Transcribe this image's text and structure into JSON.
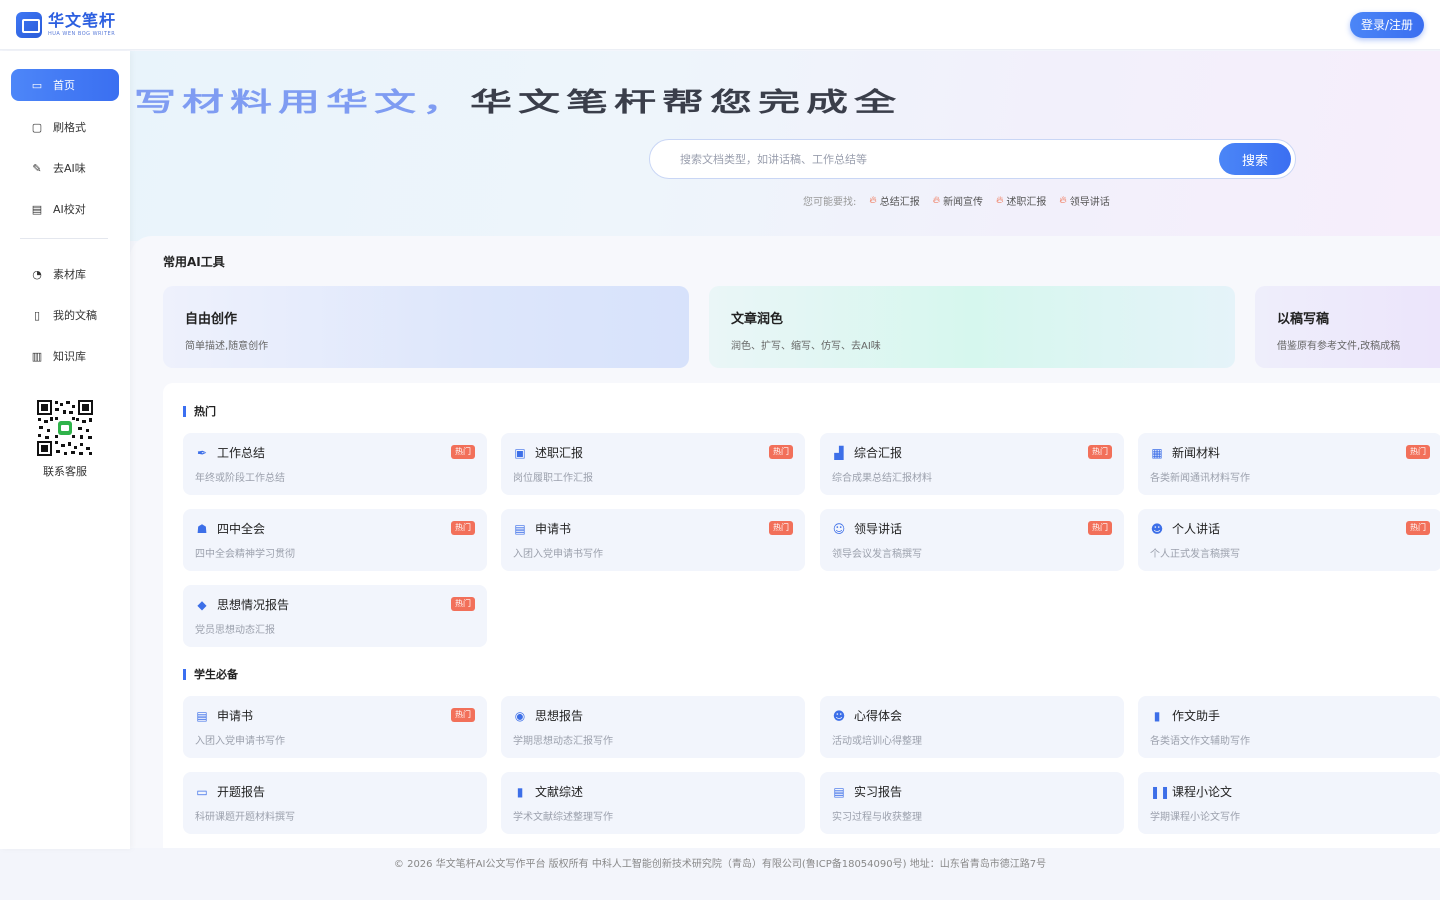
{
  "header": {
    "logo_cn": "华文笔杆",
    "logo_en": "HUA WEN BOG WRITER",
    "login_label": "登录/注册"
  },
  "sidebar": {
    "items": [
      {
        "label": "首页",
        "icon": "home-icon",
        "active": true
      },
      {
        "label": "刷格式",
        "icon": "format-icon",
        "active": false
      },
      {
        "label": "去AI味",
        "icon": "pen-icon",
        "active": false
      },
      {
        "label": "AI校对",
        "icon": "proofread-icon",
        "active": false
      }
    ],
    "items2": [
      {
        "label": "素材库",
        "icon": "material-icon"
      },
      {
        "label": "我的文稿",
        "icon": "document-icon"
      },
      {
        "label": "知识库",
        "icon": "library-icon"
      }
    ],
    "qr_label": "联系客服"
  },
  "hero": {
    "title_part1": "写材料用华文，",
    "title_part2": "华文笔杆帮您完成全",
    "search_placeholder": "搜索文档类型，如讲话稿、工作总结等",
    "search_button": "搜索",
    "suggest_label": "您可能要找:",
    "suggest_tags": [
      "总结汇报",
      "新闻宣传",
      "述职汇报",
      "领导讲话"
    ]
  },
  "tools": {
    "title": "常用AI工具",
    "cards": [
      {
        "name": "自由创作",
        "desc": "简单描述,随意创作"
      },
      {
        "name": "文章润色",
        "desc": "润色、扩写、缩写、仿写、去AI味"
      },
      {
        "name": "以稿写稿",
        "desc": "借鉴原有参考文件,改稿成稿"
      }
    ]
  },
  "hot": {
    "title": "热门",
    "badge": "热门",
    "items": [
      {
        "name": "工作总结",
        "desc": "年终或阶段工作总结",
        "icon": "summary-icon",
        "hot": true
      },
      {
        "name": "述职汇报",
        "desc": "岗位履职工作汇报",
        "icon": "report-icon",
        "hot": true
      },
      {
        "name": "综合汇报",
        "desc": "综合成果总结汇报材料",
        "icon": "chart-icon",
        "hot": true
      },
      {
        "name": "新闻材料",
        "desc": "各类新闻通讯材料写作",
        "icon": "news-icon",
        "hot": true
      },
      {
        "name": "四中全会",
        "desc": "四中全会精神学习贯彻",
        "icon": "people-icon",
        "hot": true
      },
      {
        "name": "申请书",
        "desc": "入团入党申请书写作",
        "icon": "application-icon",
        "hot": true
      },
      {
        "name": "领导讲话",
        "desc": "领导会议发言稿撰写",
        "icon": "speaker-icon",
        "hot": true
      },
      {
        "name": "个人讲话",
        "desc": "个人正式发言稿撰写",
        "icon": "person-icon",
        "hot": true
      },
      {
        "name": "思想情况报告",
        "desc": "党员思想动态汇报",
        "icon": "thought-icon",
        "hot": true
      }
    ]
  },
  "student": {
    "title": "学生必备",
    "items": [
      {
        "name": "申请书",
        "desc": "入团入党申请书写作",
        "icon": "application-icon",
        "hot": true
      },
      {
        "name": "思想报告",
        "desc": "学期思想动态汇报写作",
        "icon": "thought-icon",
        "hot": false
      },
      {
        "name": "心得体会",
        "desc": "活动或培训心得整理",
        "icon": "experience-icon",
        "hot": false
      },
      {
        "name": "作文助手",
        "desc": "各类语文作文辅助写作",
        "icon": "essay-icon",
        "hot": false
      },
      {
        "name": "开题报告",
        "desc": "科研课题开题材料撰写",
        "icon": "proposal-icon",
        "hot": false
      },
      {
        "name": "文献综述",
        "desc": "学术文献综述整理写作",
        "icon": "literature-icon",
        "hot": false
      },
      {
        "name": "实习报告",
        "desc": "实习过程与收获整理",
        "icon": "internship-icon",
        "hot": false
      },
      {
        "name": "课程小论文",
        "desc": "学期课程小论文写作",
        "icon": "books-icon",
        "hot": false
      }
    ]
  },
  "footer": {
    "text": "© 2026 华文笔杆AI公文写作平台 版权所有 中科人工智能创新技术研究院（青岛）有限公司(鲁ICP备18054090号) 地址：山东省青岛市德江路7号"
  }
}
